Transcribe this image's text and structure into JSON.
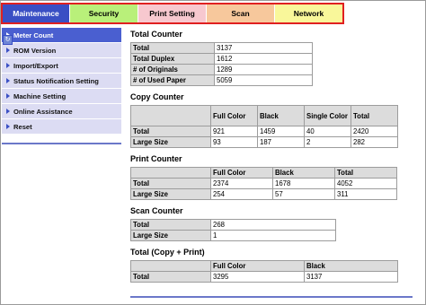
{
  "tabs": [
    {
      "label": "Maintenance"
    },
    {
      "label": "Security"
    },
    {
      "label": "Print Setting"
    },
    {
      "label": "Scan"
    },
    {
      "label": "Network"
    }
  ],
  "sidebar": {
    "items": [
      {
        "label": "Meter Count"
      },
      {
        "label": "ROM Version"
      },
      {
        "label": "Import/Export"
      },
      {
        "label": "Status Notification Setting"
      },
      {
        "label": "Machine Setting"
      },
      {
        "label": "Online Assistance"
      },
      {
        "label": "Reset"
      }
    ]
  },
  "total_counter": {
    "title": "Total Counter",
    "rows": [
      {
        "label": "Total",
        "value": "3137"
      },
      {
        "label": "Total Duplex",
        "value": "1612"
      },
      {
        "label": "# of Originals",
        "value": "1289"
      },
      {
        "label": "# of Used Paper",
        "value": "5059"
      }
    ]
  },
  "copy_counter": {
    "title": "Copy Counter",
    "headers": [
      "Full Color",
      "Black",
      "Single Color",
      "Total"
    ],
    "rows": [
      {
        "label": "Total",
        "values": [
          "921",
          "1459",
          "40",
          "2420"
        ]
      },
      {
        "label": "Large Size",
        "values": [
          "93",
          "187",
          "2",
          "282"
        ]
      }
    ]
  },
  "print_counter": {
    "title": "Print Counter",
    "headers": [
      "Full Color",
      "Black",
      "Total"
    ],
    "rows": [
      {
        "label": "Total",
        "values": [
          "2374",
          "1678",
          "4052"
        ]
      },
      {
        "label": "Large Size",
        "values": [
          "254",
          "57",
          "311"
        ]
      }
    ]
  },
  "scan_counter": {
    "title": "Scan Counter",
    "rows": [
      {
        "label": "Total",
        "value": "268"
      },
      {
        "label": "Large Size",
        "value": "1"
      }
    ]
  },
  "total_copy_print": {
    "title": "Total (Copy + Print)",
    "headers": [
      "Full Color",
      "Black"
    ],
    "rows": [
      {
        "label": "Total",
        "values": [
          "3295",
          "3137"
        ]
      }
    ]
  },
  "colors": {
    "accent": "#3a4fc4",
    "tab_security": "#b9f07a",
    "tab_print": "#f7c8cf",
    "tab_scan": "#f7c89c",
    "tab_network": "#f9f79a",
    "highlight_border": "#e02020"
  }
}
